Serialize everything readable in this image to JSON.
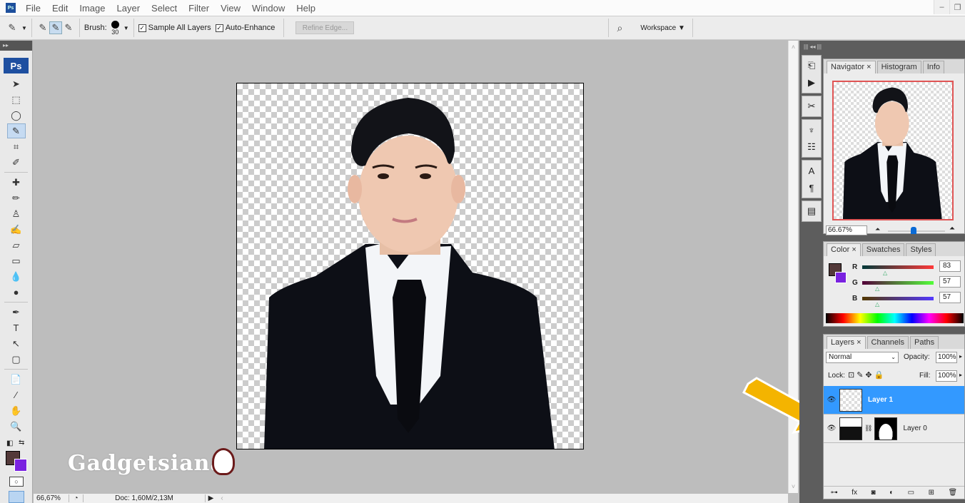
{
  "app": {
    "logo_text": "Ps"
  },
  "menu": [
    "File",
    "Edit",
    "Image",
    "Layer",
    "Select",
    "Filter",
    "View",
    "Window",
    "Help"
  ],
  "window_controls": {
    "minimize": "–",
    "restore": "❐"
  },
  "options_bar": {
    "brush_label": "Brush:",
    "brush_size": "30",
    "sample_all_layers": {
      "label": "Sample All Layers",
      "checked": true
    },
    "auto_enhance": {
      "label": "Auto-Enhance",
      "checked": true
    },
    "refine_edge_label": "Refine Edge...",
    "workspace_label": "Workspace ▼"
  },
  "toolbox": {
    "badge": "Ps",
    "tools": [
      {
        "name": "move-tool",
        "glyph": "➤"
      },
      {
        "name": "marquee-tool",
        "glyph": "⬚"
      },
      {
        "name": "lasso-tool",
        "glyph": "◯"
      },
      {
        "name": "quick-selection-tool",
        "glyph": "✎",
        "selected": true
      },
      {
        "name": "crop-tool",
        "glyph": "⌗"
      },
      {
        "name": "slice-tool",
        "glyph": "✐"
      },
      {
        "sep": true
      },
      {
        "name": "healing-brush-tool",
        "glyph": "✚"
      },
      {
        "name": "brush-tool",
        "glyph": "✏"
      },
      {
        "name": "clone-stamp-tool",
        "glyph": "♙"
      },
      {
        "name": "history-brush-tool",
        "glyph": "✍"
      },
      {
        "name": "eraser-tool",
        "glyph": "▱"
      },
      {
        "name": "gradient-tool",
        "glyph": "▭"
      },
      {
        "name": "blur-tool",
        "glyph": "💧"
      },
      {
        "name": "dodge-tool",
        "glyph": "●"
      },
      {
        "sep": true
      },
      {
        "name": "pen-tool",
        "glyph": "✒"
      },
      {
        "name": "type-tool",
        "glyph": "T"
      },
      {
        "name": "path-selection-tool",
        "glyph": "↖"
      },
      {
        "name": "shape-tool",
        "glyph": "▢"
      },
      {
        "sep": true
      },
      {
        "name": "notes-tool",
        "glyph": "📄"
      },
      {
        "name": "eyedropper-tool",
        "glyph": "⁄"
      },
      {
        "name": "hand-tool",
        "glyph": "✋"
      },
      {
        "name": "zoom-tool",
        "glyph": "🔍"
      }
    ],
    "foreground_color": "#533939",
    "background_color": "#7a22e0"
  },
  "status_bar": {
    "zoom": "66,67%",
    "doc_info": "Doc: 1,60M/2,13M"
  },
  "watermark": "Gadgetsiana",
  "navigator": {
    "tabs": [
      {
        "label": "Navigator ×",
        "active": true
      },
      {
        "label": "Histogram"
      },
      {
        "label": "Info"
      }
    ],
    "zoom_value": "66.67%",
    "zoom_slider_fraction": 0.45
  },
  "color_panel": {
    "tabs": [
      {
        "label": "Color ×",
        "active": true
      },
      {
        "label": "Swatches"
      },
      {
        "label": "Styles"
      }
    ],
    "channels": [
      {
        "label": "R",
        "value": "83",
        "fraction": 0.33,
        "track": "linear-gradient(90deg,#003939,#ff3939)"
      },
      {
        "label": "G",
        "value": "57",
        "fraction": 0.22,
        "track": "linear-gradient(90deg,#530039,#53ff39)"
      },
      {
        "label": "B",
        "value": "57",
        "fraction": 0.22,
        "track": "linear-gradient(90deg,#533900,#5339ff)"
      }
    ],
    "foreground_color": "#533939",
    "background_color": "#7a22e0"
  },
  "layers_panel": {
    "tabs": [
      {
        "label": "Layers ×",
        "active": true
      },
      {
        "label": "Channels"
      },
      {
        "label": "Paths"
      }
    ],
    "blend_mode": "Normal",
    "opacity_label": "Opacity:",
    "opacity_value": "100%",
    "lock_label": "Lock:",
    "fill_label": "Fill:",
    "fill_value": "100%",
    "layers": [
      {
        "name": "Layer 1",
        "selected": true,
        "visible": true
      },
      {
        "name": "Layer 0",
        "selected": false,
        "visible": true,
        "has_mask": true
      }
    ],
    "footer_icons": [
      "link-icon",
      "fx-icon",
      "mask-icon",
      "adjustment-icon",
      "folder-icon",
      "new-layer-icon",
      "trash-icon"
    ],
    "footer_glyphs": [
      "⊶",
      "fx",
      "◙",
      "◐",
      "▭",
      "⊞",
      "🗑"
    ]
  }
}
